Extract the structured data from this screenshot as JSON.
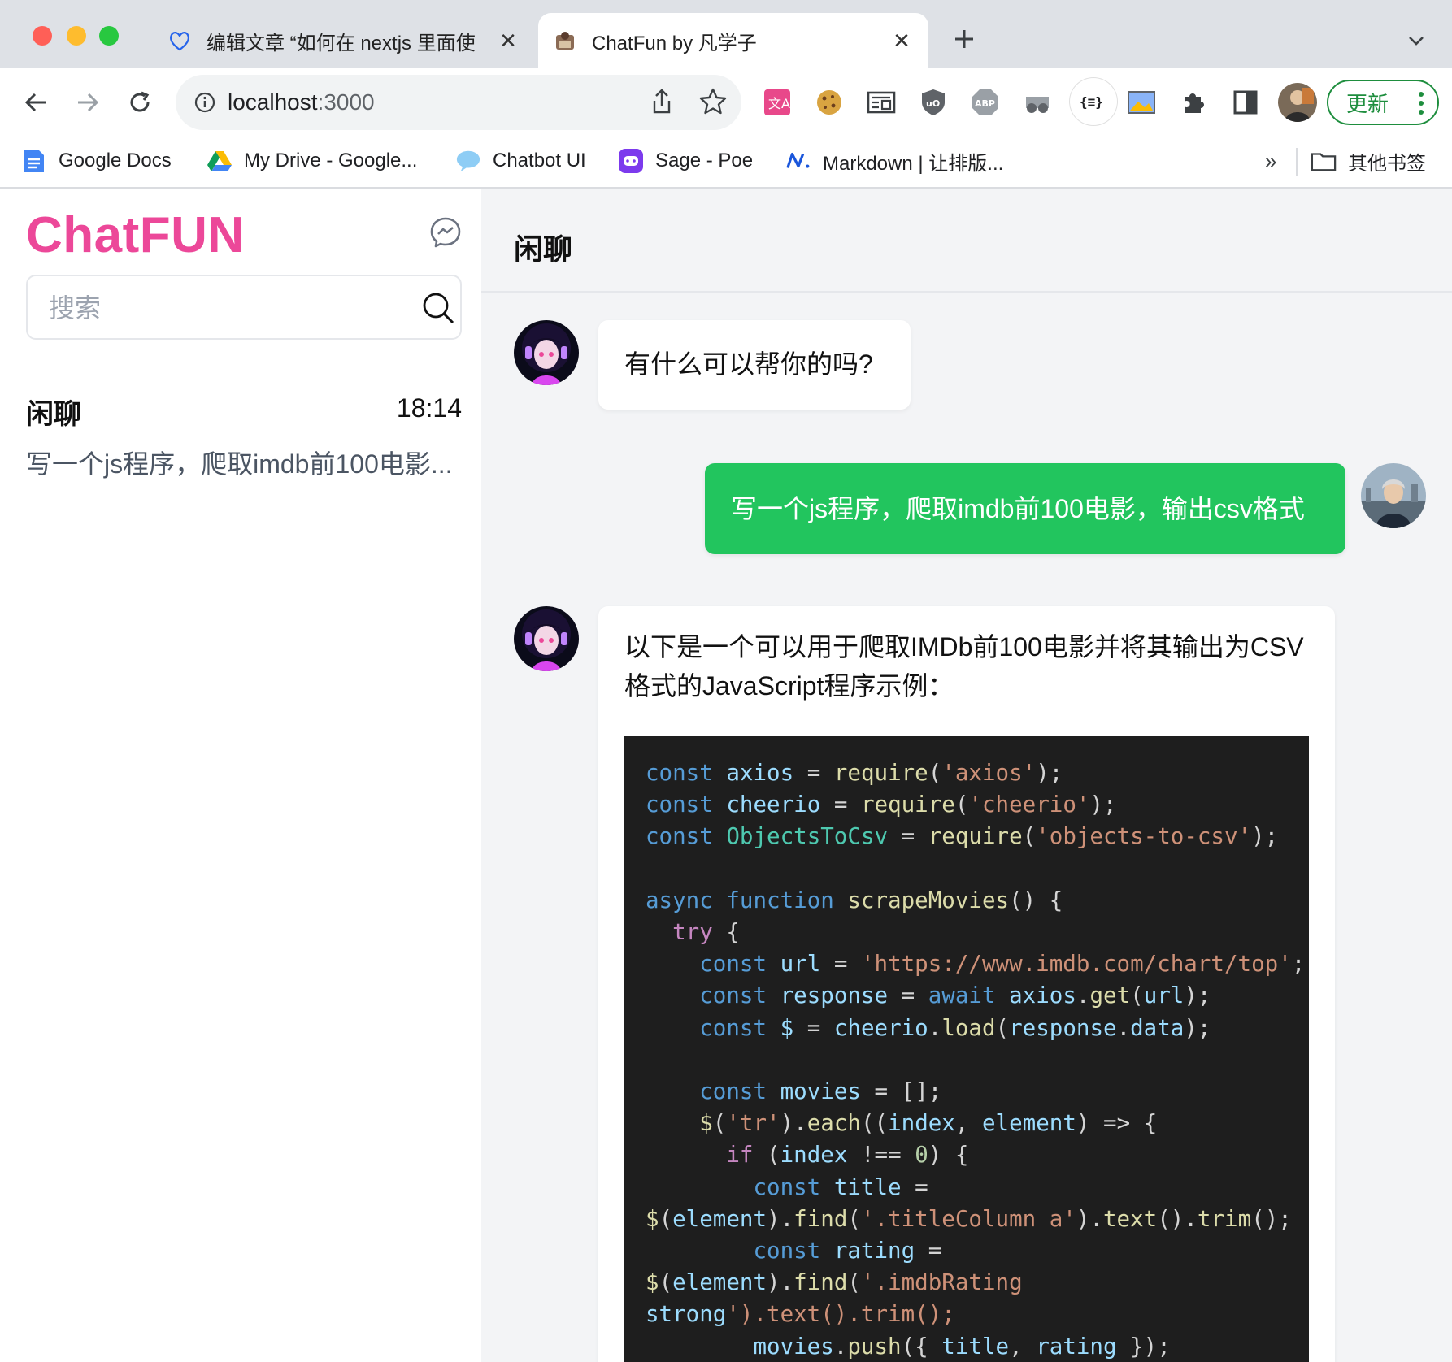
{
  "browser": {
    "tabs": [
      {
        "title": "编辑文章 “如何在 nextjs 里面使",
        "active": false,
        "icon": "heart-outline-icon"
      },
      {
        "title": "ChatFun by 凡学子",
        "active": true,
        "icon": "site-favicon"
      }
    ],
    "url_host": "localhost",
    "url_port": ":3000",
    "update_label": "更新",
    "bookmarks": [
      {
        "label": "Google Docs",
        "icon": "google-docs-icon"
      },
      {
        "label": "My Drive - Google...",
        "icon": "google-drive-icon"
      },
      {
        "label": "Chatbot UI",
        "icon": "chat-bubble-icon"
      },
      {
        "label": "Sage - Poe",
        "icon": "poe-icon"
      },
      {
        "label": "Markdown | 让排版...",
        "icon": "markdown-n-icon"
      }
    ],
    "bookmarks_overflow": "»",
    "other_bookmarks": "其他书签"
  },
  "sidebar": {
    "brand": "ChatFUN",
    "brand_color": "#ec4899",
    "search_placeholder": "搜索",
    "conversations": [
      {
        "title": "闲聊",
        "time": "18:14",
        "preview": "写一个js程序，爬取imdb前100电影..."
      }
    ]
  },
  "chat": {
    "title": "闲聊",
    "messages": [
      {
        "role": "assistant",
        "text": "有什么可以帮你的吗?"
      },
      {
        "role": "user",
        "text": "写一个js程序，爬取imdb前100电影，输出csv格式"
      },
      {
        "role": "assistant",
        "text_line1": "以下是一个可以用于爬取IMDb前100电影并将其输出为CSV",
        "text_line2": "格式的JavaScript程序示例：",
        "code_language": "javascript",
        "code_lines": [
          "const axios = require('axios');",
          "const cheerio = require('cheerio');",
          "const ObjectsToCsv = require('objects-to-csv');",
          "",
          "async function scrapeMovies() {",
          "  try {",
          "    const url = 'https://www.imdb.com/chart/top';",
          "    const response = await axios.get(url);",
          "    const $ = cheerio.load(response.data);",
          "",
          "    const movies = [];",
          "    $('tr').each((index, element) => {",
          "      if (index !== 0) {",
          "        const title =",
          "$(element).find('.titleColumn a').text().trim();",
          "        const rating =",
          "$(element).find('.imdbRating",
          "strong').text().trim();",
          "        movies.push({ title, rating });"
        ]
      }
    ],
    "user_bubble_color": "#22c55e"
  }
}
